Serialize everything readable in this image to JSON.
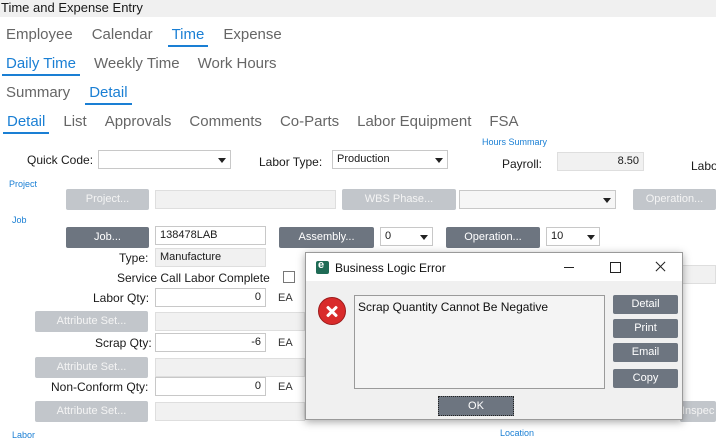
{
  "window": {
    "title": "Time and Expense Entry"
  },
  "tabs": {
    "row1": [
      "Employee",
      "Calendar",
      "Time",
      "Expense"
    ],
    "row2": [
      "Daily Time",
      "Weekly Time",
      "Work Hours"
    ],
    "row3": [
      "Summary",
      "Detail"
    ],
    "row4": [
      "Detail",
      "List",
      "Approvals",
      "Comments",
      "Co-Parts",
      "Labor Equipment",
      "FSA"
    ],
    "active": {
      "row1": "Time",
      "row2": "Daily Time",
      "row3": "Detail",
      "row4": "Detail"
    }
  },
  "form": {
    "hours_summary_label": "Hours Summary",
    "quick_code_label": "Quick Code:",
    "quick_code_value": "",
    "labor_type_label": "Labor Type:",
    "labor_type_value": "Production",
    "payroll_label": "Payroll:",
    "payroll_value": "8.50",
    "labor_cut_label": "Labo",
    "project_section": "Project",
    "project_button": "Project...",
    "wbs_phase_button": "WBS Phase...",
    "operation_button_top": "Operation...",
    "job_section": "Job",
    "job_button": "Job...",
    "job_value": "138478LAB",
    "assembly_button": "Assembly...",
    "assembly_value": "0",
    "operation_button": "Operation...",
    "operation_value": "10",
    "type_label": "Type:",
    "type_value": "Manufacture",
    "service_call_label": "Service Call Labor Complete",
    "labor_qty_label": "Labor Qty:",
    "labor_qty_value": "0",
    "scrap_qty_label": "Scrap Qty:",
    "scrap_qty_value": "-6",
    "nonconform_qty_label": "Non-Conform Qty:",
    "nonconform_qty_value": "0",
    "unit": "EA",
    "attribute_set_button": "Attribute Set...",
    "labor_section": "Labor",
    "location_section": "Location",
    "inspect_cut": "Inspec"
  },
  "dialog": {
    "title": "Business Logic Error",
    "message": "Scrap Quantity Cannot Be Negative",
    "buttons": [
      "Detail",
      "Print",
      "Email",
      "Copy"
    ],
    "ok_label": "OK"
  },
  "colors": {
    "accent": "#1a7fd4",
    "button": "#6d7580",
    "error": "#d92b2b"
  }
}
